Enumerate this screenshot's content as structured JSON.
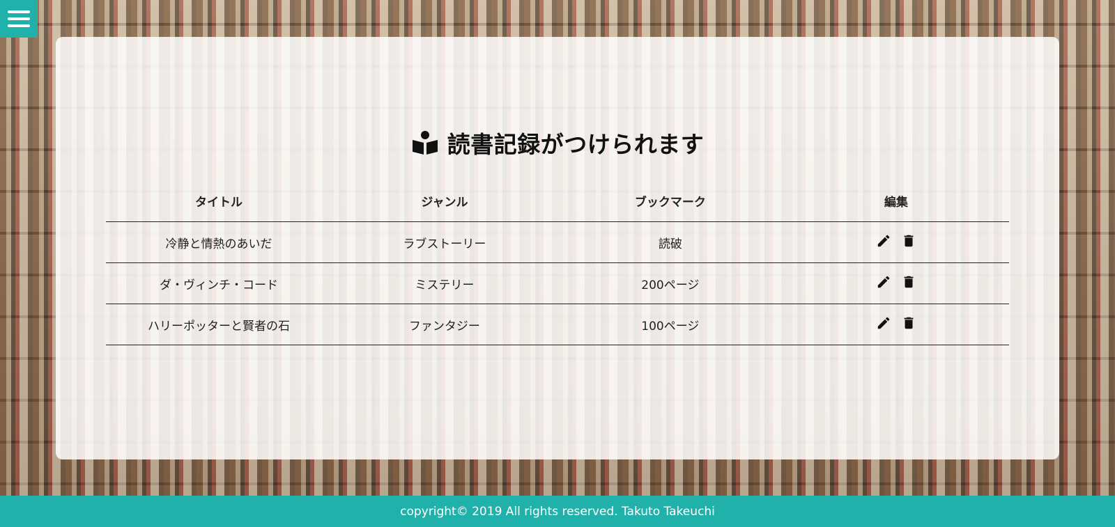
{
  "menu": {
    "icon": "hamburger-menu-icon"
  },
  "page": {
    "title": "読書記録がつけられます",
    "title_icon": "book-reader-icon"
  },
  "table": {
    "headers": [
      "タイトル",
      "ジャンル",
      "ブックマーク",
      "編集"
    ],
    "rows": [
      {
        "title": "冷静と情熱のあいだ",
        "genre": "ラブストーリー",
        "bookmark": "読破"
      },
      {
        "title": "ダ・ヴィンチ・コード",
        "genre": "ミステリー",
        "bookmark": "200ページ"
      },
      {
        "title": "ハリーポッターと賢者の石",
        "genre": "ファンタジー",
        "bookmark": "100ページ"
      }
    ],
    "row_actions": [
      "pencil-edit-icon",
      "trash-delete-icon"
    ]
  },
  "footer": {
    "text": "copyright© 2019 All rights reserved. Takuto Takeuchi"
  },
  "colors": {
    "accent": "#20b2aa",
    "panel": "#ffffff",
    "text": "#111111"
  }
}
